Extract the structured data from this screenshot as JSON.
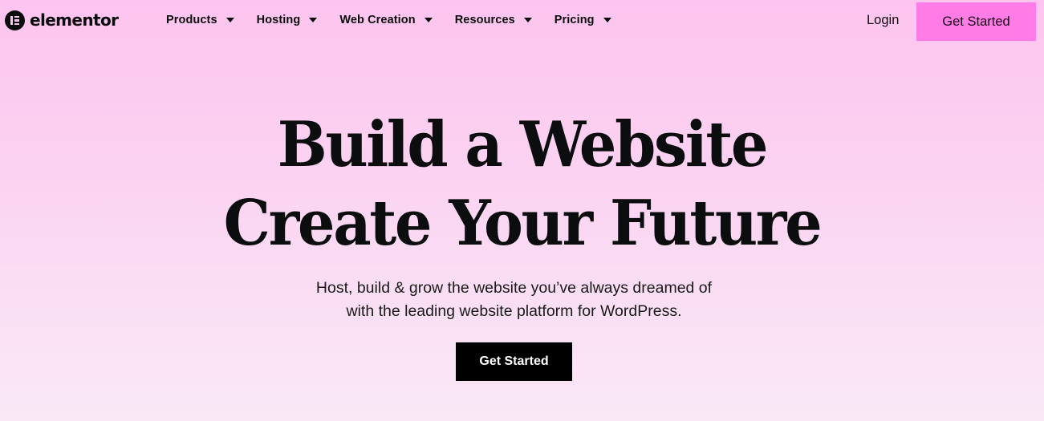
{
  "header": {
    "logo": {
      "icon": "elementor-logo-icon",
      "text": "elementor"
    },
    "nav": [
      {
        "label": "Products",
        "icon": "caret-down-icon"
      },
      {
        "label": "Hosting",
        "icon": "caret-down-icon"
      },
      {
        "label": "Web Creation",
        "icon": "caret-down-icon"
      },
      {
        "label": "Resources",
        "icon": "caret-down-icon"
      },
      {
        "label": "Pricing",
        "icon": "caret-down-icon"
      }
    ],
    "login_label": "Login",
    "cta_label": "Get Started"
  },
  "hero": {
    "title_lines": [
      "Build a Website",
      "Create Your Future"
    ],
    "subtitle_lines": [
      "Host, build & grow the website you’ve always dreamed of",
      "with the leading website platform for WordPress."
    ],
    "cta_label": "Get Started"
  },
  "colors": {
    "background_top": "#fdc4ef",
    "background_bottom": "#f9e8f6",
    "header_cta": "#ff7be5",
    "hero_cta": "#000000",
    "text": "#0c0d0e"
  }
}
